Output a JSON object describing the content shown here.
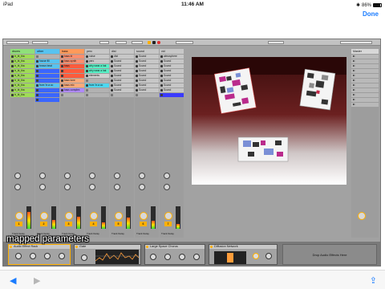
{
  "status": {
    "device": "iPad",
    "time": "11:46 AM",
    "battery": "86%",
    "battery_level": 0.86
  },
  "topbar": {
    "done_label": "Done"
  },
  "tracks": [
    {
      "name": "drums",
      "color": "#8fe07a",
      "clips": [
        {
          "t": "tr_bt_tha",
          "c": "#9fdc55"
        },
        {
          "t": "tr_bt_tha",
          "c": "#9fdc55"
        },
        {
          "t": "tr_bt_tha",
          "c": "#9fdc55"
        },
        {
          "t": "tr_bt_tha",
          "c": "#9fdc55"
        },
        {
          "t": "tr_bt_tha",
          "c": "#9fdc55"
        },
        {
          "t": "tr_bt_tha",
          "c": "#9fdc55"
        },
        {
          "t": "tr_bt_tha",
          "c": "#9fdc55"
        },
        {
          "t": "tr_bt_tha",
          "c": "#9fdc55"
        },
        {
          "t": "tr_bt_tha",
          "c": "#9fdc55"
        }
      ],
      "sends": [
        "A",
        "B"
      ],
      "number": "1",
      "label": "Track Delay",
      "meter": 0.75
    },
    {
      "name": "other",
      "color": "#57c3f0",
      "clips": [
        {
          "t": "",
          "c": "#b2b2b2"
        },
        {
          "t": "house fill",
          "c": "#57c3f0"
        },
        {
          "t": "brown beat",
          "c": "#57c3f0"
        },
        {
          "t": "",
          "c": "#3a66ff"
        },
        {
          "t": "",
          "c": "#3a66ff"
        },
        {
          "t": "",
          "c": "#3a66ff"
        },
        {
          "t": "from 'in a co",
          "c": "#57c3f0"
        },
        {
          "t": "",
          "c": "#3a66ff"
        },
        {
          "t": "",
          "c": "#3a66ff"
        },
        {
          "t": "",
          "c": "#3a66ff"
        }
      ],
      "sends": [
        "A",
        "B"
      ],
      "number": "2",
      "label": "Track Delay",
      "meter": 0.4
    },
    {
      "name": "bass",
      "color": "#ff9a5a",
      "clips": [
        {
          "t": "bass bl",
          "c": "#ff8e6e"
        },
        {
          "t": "bass synth",
          "c": "#ff8e6e"
        },
        {
          "t": "bass",
          "c": "#ff5b3c"
        },
        {
          "t": "",
          "c": "#ff5b3c"
        },
        {
          "t": "",
          "c": "#ff5b3c"
        },
        {
          "t": "bass tone",
          "c": "#ffaa7a"
        },
        {
          "t": "bass mix",
          "c": "#ffaa7a"
        },
        {
          "t": "bass complex",
          "c": "#b08aff"
        },
        {
          "t": "",
          "c": "#b2b2b2"
        }
      ],
      "sends": [
        "A",
        "B"
      ],
      "number": "3",
      "label": "Track Delay",
      "meter": 0.55
    },
    {
      "name": "perc",
      "color": "#c7c7c7",
      "clips": [
        {
          "t": "noise",
          "c": "#c7c7c7"
        },
        {
          "t": "perc",
          "c": "#c7c7c7"
        },
        {
          "t": "why wear a hat",
          "c": "#57f0c6"
        },
        {
          "t": "why wear a hat",
          "c": "#57f0c6"
        },
        {
          "t": "elements",
          "c": "#d0d0d0"
        },
        {
          "t": "",
          "c": "#b2b2b2"
        },
        {
          "t": "from 'in a co",
          "c": "#4dd8f0"
        },
        {
          "t": "",
          "c": "#b2b2b2"
        },
        {
          "t": "",
          "c": "#b2b2b2"
        }
      ],
      "sends": [
        "A",
        "B"
      ],
      "number": "4",
      "label": "Track Delay",
      "meter": 0.3
    },
    {
      "name": "dist",
      "color": "#c7c7c7",
      "clips": [
        {
          "t": "dist",
          "c": "#c7c7c7"
        },
        {
          "t": "Sound",
          "c": "#c7c7c7"
        },
        {
          "t": "Sound",
          "c": "#c7c7c7"
        },
        {
          "t": "Sound",
          "c": "#c7c7c7"
        },
        {
          "t": "Sound",
          "c": "#c7c7c7"
        },
        {
          "t": "Sound",
          "c": "#c7c7c7"
        },
        {
          "t": "Sound",
          "c": "#c7c7c7"
        },
        {
          "t": "Sound",
          "c": "#c7c7c7"
        },
        {
          "t": "",
          "c": "#b2b2b2"
        }
      ],
      "sends": [
        "A",
        "B"
      ],
      "number": "5",
      "label": "Track Delay",
      "meter": 0.5
    },
    {
      "name": "sound",
      "color": "#c7c7c7",
      "clips": [
        {
          "t": "Sound",
          "c": "#c7c7c7"
        },
        {
          "t": "Sound",
          "c": "#c7c7c7"
        },
        {
          "t": "Sound",
          "c": "#c7c7c7"
        },
        {
          "t": "Sound",
          "c": "#c7c7c7"
        },
        {
          "t": "Sound",
          "c": "#c7c7c7"
        },
        {
          "t": "Sound",
          "c": "#c7c7c7"
        },
        {
          "t": "Sound",
          "c": "#c7c7c7"
        },
        {
          "t": "Sound",
          "c": "#c7c7c7"
        },
        {
          "t": "",
          "c": "#b2b2b2"
        }
      ],
      "sends": [
        "A",
        "B"
      ],
      "number": "6",
      "label": "Track Delay",
      "meter": 0.35
    },
    {
      "name": "vid",
      "color": "#c7c7c7",
      "clips": [
        {
          "t": "atmosphere",
          "c": "#c7c7c7"
        },
        {
          "t": "Sound",
          "c": "#c7c7c7"
        },
        {
          "t": "Sound",
          "c": "#c7c7c7"
        },
        {
          "t": "Sound",
          "c": "#c7c7c7"
        },
        {
          "t": "Sound",
          "c": "#c7c7c7"
        },
        {
          "t": "Sound",
          "c": "#c7c7c7"
        },
        {
          "t": "Sound",
          "c": "#c7c7c7"
        },
        {
          "t": "Sound",
          "c": "#c7c7c7"
        },
        {
          "t": "",
          "c": "#3a3aff"
        }
      ],
      "sends": [
        "A",
        "B"
      ],
      "number": "7",
      "label": "Track Delay",
      "meter": 0.2
    }
  ],
  "master": {
    "title": "Master"
  },
  "devices": {
    "rack": "Audio Effect Rack",
    "gate": "Gate",
    "chorus": "Large Space Chorus",
    "diffusion": "Diffusion Network",
    "drop": "Drop Audio Effects Here"
  },
  "caption": "mapped parameters",
  "nav": {
    "back": "◀",
    "forward": "▶",
    "share": "⇪"
  }
}
